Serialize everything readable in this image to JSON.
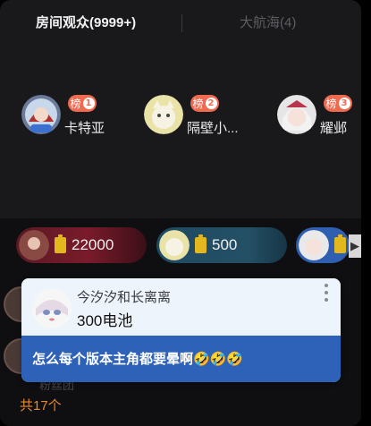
{
  "tabs": {
    "audience": "房间观众(9999+)",
    "fleet": "大航海(4)"
  },
  "top_rank": [
    {
      "badge": "榜",
      "rank": "1",
      "nickname": "卡特亚",
      "crown": "舰长"
    },
    {
      "badge": "榜",
      "rank": "2",
      "nickname": "隔壁小..."
    },
    {
      "badge": "榜",
      "rank": "3",
      "nickname": "耀邺"
    }
  ],
  "gift_chips": [
    {
      "value": "22000"
    },
    {
      "value": "500"
    }
  ],
  "popup": {
    "name": "今汐汐和长离离",
    "gift": "300电池",
    "message": "怎么每个版本主角都要晕啊🤣🤣🤣"
  },
  "fan_row": "粉丝团",
  "total": "共17个",
  "colors": {
    "accent_orange": "#e8892b",
    "badge_red": "#f06a50",
    "message_blue": "#2d62b8"
  }
}
